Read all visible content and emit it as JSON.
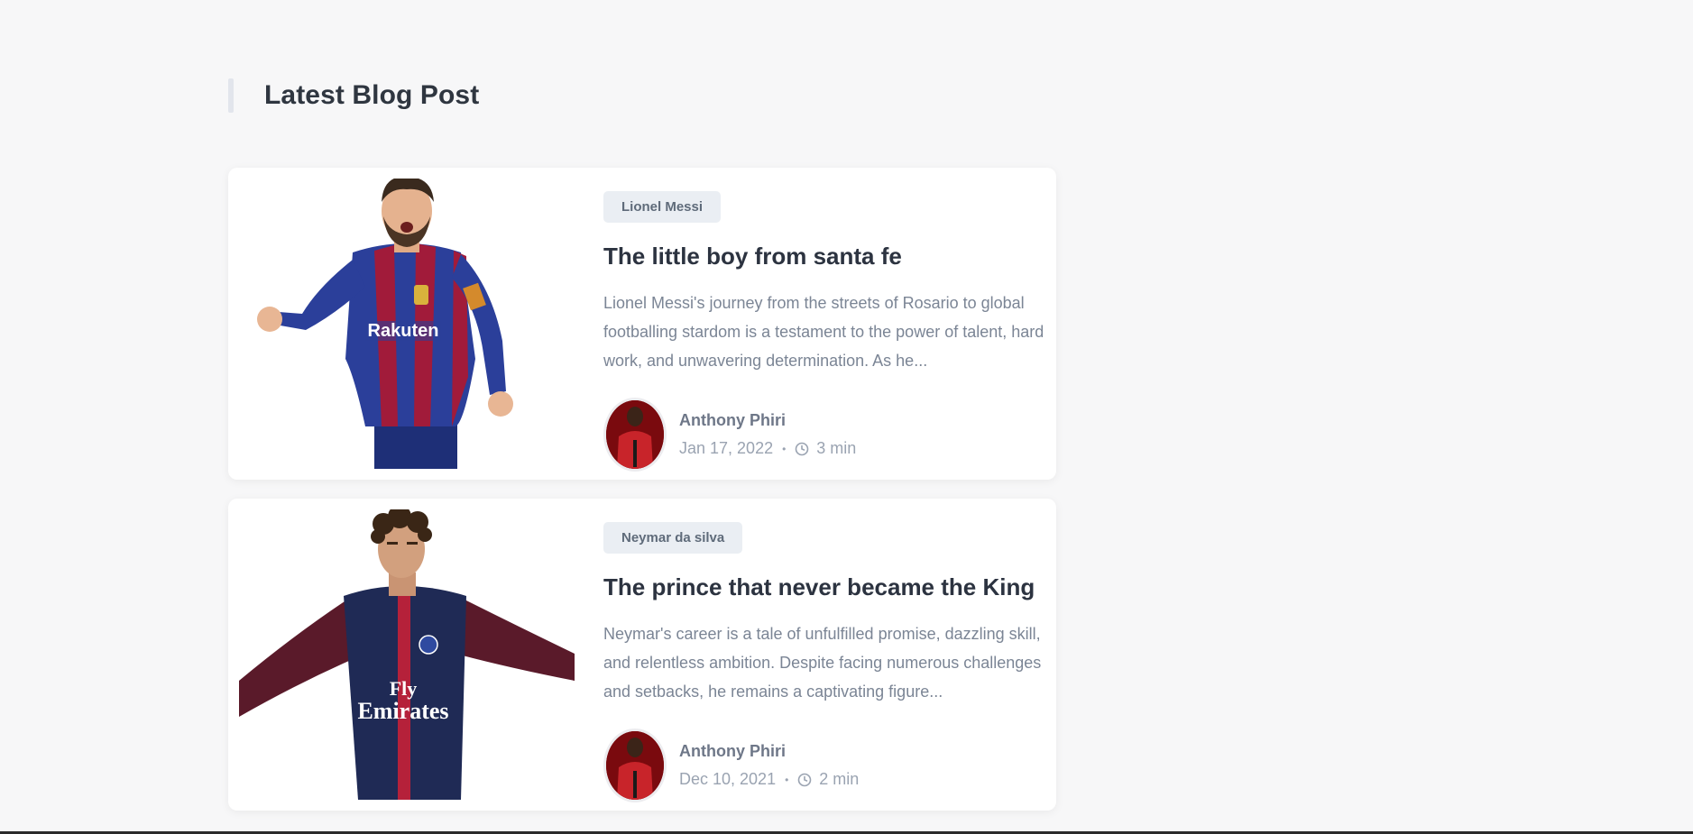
{
  "section": {
    "title": "Latest Blog Post"
  },
  "posts": [
    {
      "tag": "Lionel Messi",
      "title": "The little boy from santa fe",
      "excerpt": "Lionel Messi's journey from the streets of Rosario to global footballing stardom is a testament to the power of talent, hard work, and unwavering determination. As he...",
      "author": "Anthony Phiri",
      "date": "Jan 17, 2022",
      "separator": "•",
      "read_time": "3 min",
      "image_alt": "lionel-messi-photo"
    },
    {
      "tag": "Neymar da silva",
      "title": "The prince that never became the King",
      "excerpt": "Neymar's career is a tale of unfulfilled promise, dazzling skill, and relentless ambition. Despite facing numerous challenges and setbacks, he remains a captivating figure...",
      "author": "Anthony Phiri",
      "date": "Dec 10, 2021",
      "separator": "•",
      "read_time": "2 min",
      "image_alt": "neymar-photo"
    }
  ],
  "colors": {
    "background": "#f7f7f8",
    "card": "#ffffff",
    "title": "#2c3340",
    "muted": "#7b8595",
    "tag_bg": "#eaeef3"
  }
}
